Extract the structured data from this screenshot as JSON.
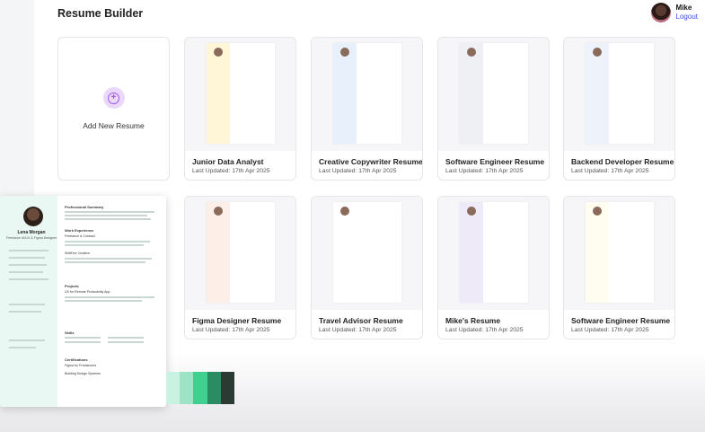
{
  "header": {
    "title": "Resume Builder"
  },
  "user": {
    "name": "Mike",
    "logout_label": "Logout"
  },
  "add_card": {
    "label": "Add New Resume"
  },
  "cards": [
    {
      "title": "Junior Data Analyst",
      "date": "Last Updated: 17th Apr 2025",
      "accent": "#fff6d8"
    },
    {
      "title": "Creative Copywriter Resume",
      "date": "Last Updated: 17th Apr 2025",
      "accent": "#e8f1fb"
    },
    {
      "title": "Software Engineer Resume",
      "date": "Last Updated: 17th Apr 2025",
      "accent": "#eef0f4"
    },
    {
      "title": "Backend Developer Resume",
      "date": "Last Updated: 17th Apr 2025",
      "accent": "#eef3fb"
    },
    {
      "title": "Figma Designer Resume",
      "date": "Last Updated: 17th Apr 2025",
      "accent": "#fdeee8"
    },
    {
      "title": "Travel Advisor Resume",
      "date": "Last Updated: 17th Apr 2025",
      "accent": "#ffffff"
    },
    {
      "title": "Mike's Resume",
      "date": "Last Updated: 17th Apr 2025",
      "accent": "#eeeaf8"
    },
    {
      "title": "Software Engineer Resume",
      "date": "Last Updated: 17th Apr 2025",
      "accent": "#fffdf0"
    }
  ],
  "preview": {
    "name": "Lena Morgan",
    "role": "Freelance UI/UX & Figma Designer",
    "sections": [
      "Professional Summary",
      "Work Experience",
      "Projects",
      "Skills",
      "Certifications"
    ],
    "items": [
      "Freelance & Contract",
      "ShiftDev Creative",
      "UX for Remote Productivity App",
      "Figma for Freelancers",
      "Building Design Systems"
    ]
  },
  "swatch_colors": [
    "#c9f2e2",
    "#9ee3c6",
    "#3fcf8e",
    "#2a8c63",
    "#2b3a33"
  ]
}
